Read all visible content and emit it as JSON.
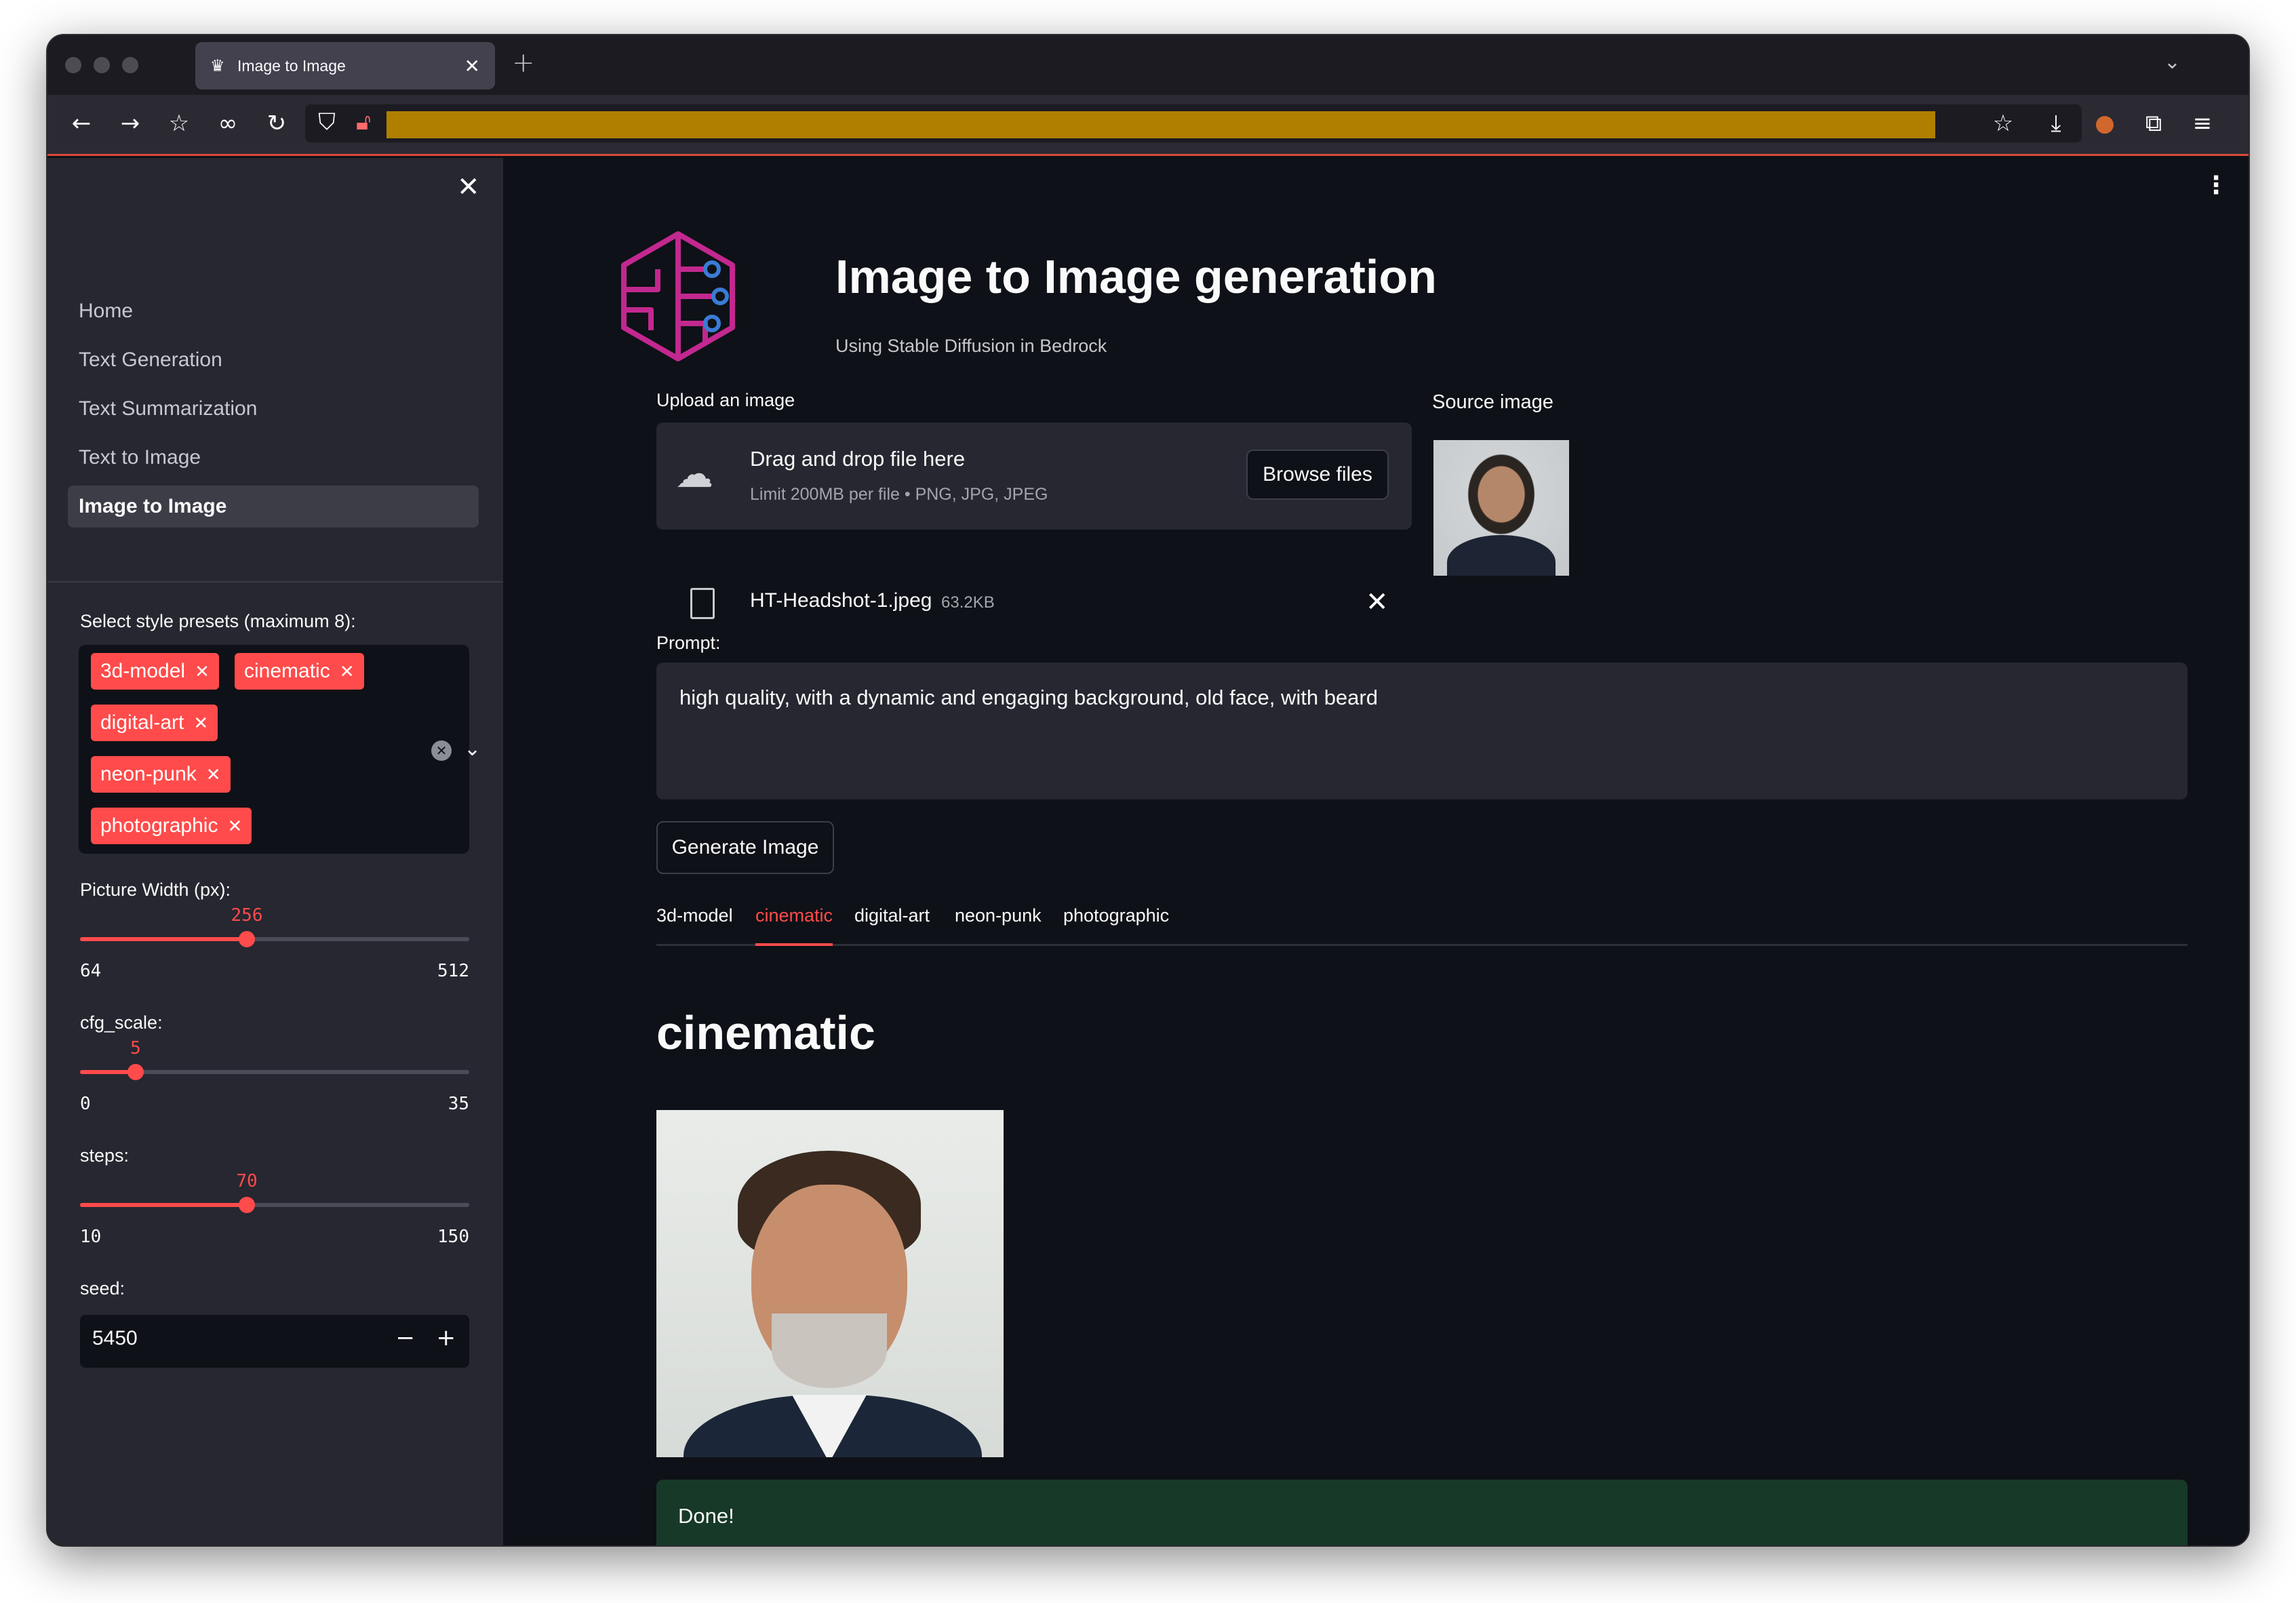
{
  "browser": {
    "tab_title": "Image to Image",
    "new_tab_icon": "plus-icon",
    "tab_list_icon": "chevron-down-icon"
  },
  "sidebar": {
    "nav_items": [
      {
        "label": "Home"
      },
      {
        "label": "Text Generation"
      },
      {
        "label": "Text Summarization"
      },
      {
        "label": "Text to Image"
      },
      {
        "label": "Image to Image",
        "active": true
      }
    ],
    "style_presets": {
      "label": "Select style presets (maximum 8):",
      "selected": [
        "3d-model",
        "cinematic",
        "digital-art",
        "neon-punk",
        "photographic"
      ]
    },
    "width_slider": {
      "label": "Picture Width (px):",
      "value": "256",
      "min": "64",
      "max": "512",
      "fraction": 0.4286
    },
    "cfg_slider": {
      "label": "cfg_scale:",
      "value": "5",
      "min": "0",
      "max": "35",
      "fraction": 0.1429
    },
    "steps_slider": {
      "label": "steps:",
      "value": "70",
      "min": "10",
      "max": "150",
      "fraction": 0.4286
    },
    "seed": {
      "label": "seed:",
      "value": "5450",
      "minus": "−",
      "plus": "+"
    }
  },
  "main": {
    "title": "Image to Image generation",
    "subtitle": "Using Stable Diffusion in Bedrock",
    "upload": {
      "label": "Upload an image",
      "drag_text": "Drag and drop file here",
      "limit_text": "Limit 200MB per file • PNG, JPG, JPEG",
      "browse_label": "Browse files",
      "file_name": "HT-Headshot-1.jpeg",
      "file_size": "63.2KB"
    },
    "source_image_label": "Source image",
    "prompt": {
      "label": "Prompt:",
      "value": "high quality, with a dynamic and engaging background, old face, with beard"
    },
    "generate_label": "Generate Image",
    "tabs": [
      "3d-model",
      "cinematic",
      "digital-art",
      "neon-punk",
      "photographic"
    ],
    "active_tab": "cinematic",
    "result_heading": "cinematic",
    "status": "Done!"
  },
  "colors": {
    "accent": "#ff4b4b",
    "background": "#0e1117",
    "sidebar": "#262730",
    "success_bg": "#173928",
    "logo": "#c2288f"
  }
}
